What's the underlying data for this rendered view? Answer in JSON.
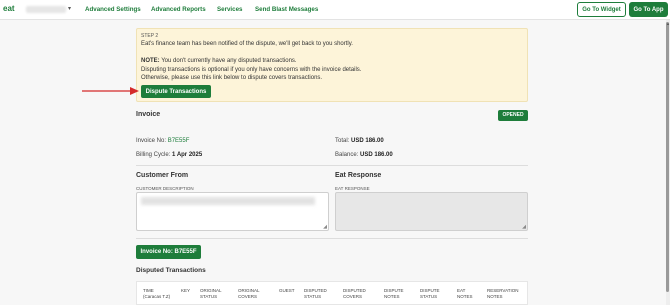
{
  "header": {
    "logo": "eat",
    "nav": [
      "Advanced Settings",
      "Advanced Reports",
      "Services",
      "Send Blast Messages"
    ],
    "go_to_widget": "Go To Widget",
    "go_to_app": "Go To App"
  },
  "notice": {
    "step": "STEP 2",
    "line1": "Eat's finance team has been notified of the dispute, we'll get back to you shortly.",
    "note_label": "NOTE:",
    "note_text": "You don't currently have any disputed transactions.",
    "line3": "Disputing transactions is optional if you only have concerns with the invoice details.",
    "line4": "Otherwise, please use this link below to dispute covers transactions.",
    "button": "Dispute Transactions"
  },
  "invoice": {
    "title": "Invoice",
    "status": "OPENED",
    "invoice_no_label": "Invoice No:",
    "invoice_no": "B7E55F",
    "total_label": "Total:",
    "total": "USD 186.00",
    "billing_label": "Billing Cycle:",
    "billing": "1 Apr 2025",
    "balance_label": "Balance:",
    "balance": "USD 186.00"
  },
  "customer": {
    "title": "Customer From",
    "desc_label": "CUSTOMER DESCRIPTION"
  },
  "eat_response": {
    "title": "Eat Response",
    "label": "EAT RESPONSE"
  },
  "invoice_button": "Invoice No: B7E55F",
  "disputed": {
    "title": "Disputed Transactions",
    "columns": [
      "TIME\n(Caracas T.Z)",
      "KEY",
      "ORIGINAL\nSTATUS",
      "ORIGINAL\nCOVERS",
      "GUEST",
      "DISPUTED\nSTATUS",
      "DISPUTED\nCOVERS",
      "DISPUTE\nNOTES",
      "DISPUTE\nSTATUS",
      "EAT\nNOTES",
      "RESERVATION\nNOTES"
    ]
  },
  "colors": {
    "brand": "#1e7d3b",
    "notice_bg": "#fdf4d9",
    "arrow": "#d42a2a"
  }
}
